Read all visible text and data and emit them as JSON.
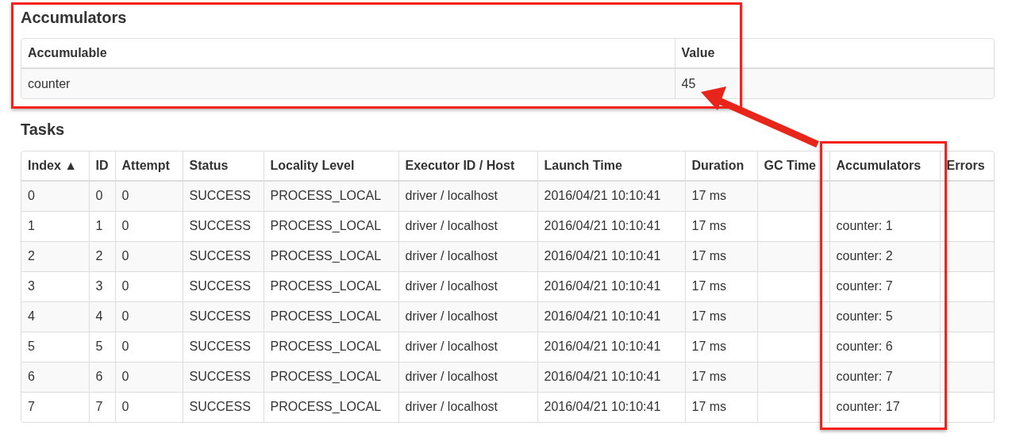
{
  "accumulators": {
    "title": "Accumulators",
    "columns": [
      "Accumulable",
      "Value"
    ],
    "rows": [
      [
        "counter",
        "45"
      ]
    ]
  },
  "tasks": {
    "title": "Tasks",
    "columns": [
      "Index ▲",
      "ID",
      "Attempt",
      "Status",
      "Locality Level",
      "Executor ID / Host",
      "Launch Time",
      "Duration",
      "GC Time",
      "Accumulators",
      "Errors"
    ],
    "rows": [
      [
        "0",
        "0",
        "0",
        "SUCCESS",
        "PROCESS_LOCAL",
        "driver / localhost",
        "2016/04/21 10:10:41",
        "17 ms",
        "",
        "",
        ""
      ],
      [
        "1",
        "1",
        "0",
        "SUCCESS",
        "PROCESS_LOCAL",
        "driver / localhost",
        "2016/04/21 10:10:41",
        "17 ms",
        "",
        "counter: 1",
        ""
      ],
      [
        "2",
        "2",
        "0",
        "SUCCESS",
        "PROCESS_LOCAL",
        "driver / localhost",
        "2016/04/21 10:10:41",
        "17 ms",
        "",
        "counter: 2",
        ""
      ],
      [
        "3",
        "3",
        "0",
        "SUCCESS",
        "PROCESS_LOCAL",
        "driver / localhost",
        "2016/04/21 10:10:41",
        "17 ms",
        "",
        "counter: 7",
        ""
      ],
      [
        "4",
        "4",
        "0",
        "SUCCESS",
        "PROCESS_LOCAL",
        "driver / localhost",
        "2016/04/21 10:10:41",
        "17 ms",
        "",
        "counter: 5",
        ""
      ],
      [
        "5",
        "5",
        "0",
        "SUCCESS",
        "PROCESS_LOCAL",
        "driver / localhost",
        "2016/04/21 10:10:41",
        "17 ms",
        "",
        "counter: 6",
        ""
      ],
      [
        "6",
        "6",
        "0",
        "SUCCESS",
        "PROCESS_LOCAL",
        "driver / localhost",
        "2016/04/21 10:10:41",
        "17 ms",
        "",
        "counter: 7",
        ""
      ],
      [
        "7",
        "7",
        "0",
        "SUCCESS",
        "PROCESS_LOCAL",
        "driver / localhost",
        "2016/04/21 10:10:41",
        "17 ms",
        "",
        "counter: 17",
        ""
      ]
    ]
  }
}
